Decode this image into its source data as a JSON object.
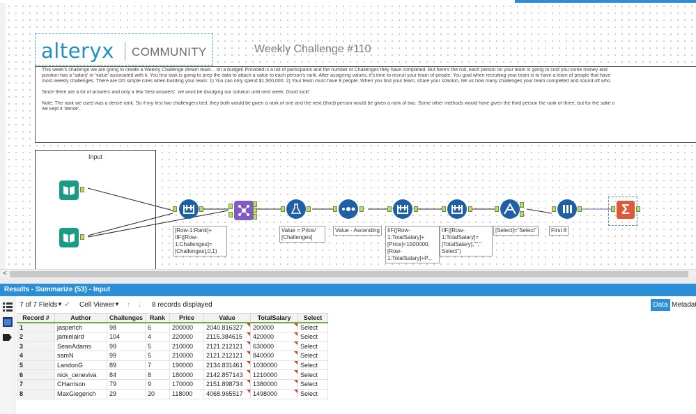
{
  "canvas": {
    "logo_word": "alteryx",
    "logo_sub": "COMMUNITY",
    "challenge_title": "Weekly Challenge #110",
    "comment_paragraphs": [
      "This week's challenge we are going to create a Weekly Challenge dream team... on a budget!  Provided is a list of participants and the number of Challenges they have completed. But here's the rub,  each person on your team is going to cost you some money and",
      "position has a 'salary' or 'value' associated with it.  You first task is going to prep the data to attach a value to each person's rank. After assigning values, it's time to recruit your team of people. You goal when recruiting your team is to have a team of people that have",
      "most weekly challenges. There are t20 simple rules when building your team: 1) You can only spend $1,500,000. 2) Your team must have 8 people. When you find your team, share your solution, tell us how many challenges your team completed and sound off who",
      "Since there are a lot of answers and only a few 'best answers', we wont be divulging our solution until next week. Good luck!",
      "Note: The rank we used was a dense rank. So if my first two challengers tied, they both would be given a rank of one and the next (third) person would be given a rank of two. Some other methods would have given the third person the rank of three, but for the sake o",
      "we kept it 'dense'."
    ],
    "input_container_label": "Input",
    "tool_labels": {
      "formula1": "[Row-1:Rank]+\nIIF([Row-\n1:Challenges]=\n[Challenges],0,1)",
      "formula2": "Value = Price/\n[Challenges]",
      "sort": "Value - Ascending",
      "multirow": "IIF([Row-\n1:TotalSalary]+\n[Price]<1500000,\n[Row-\n1:TotalSalary]+P...",
      "multirow2": "IIF([Row-\n1:TotalSalary]=\n[TotalSalary],\"\",\"\nSelect\")",
      "filter": "[Select]=\"Select\"",
      "sample": "First 8"
    }
  },
  "results": {
    "header": "Results - Summarize (53) - Input",
    "fields": "7 of 7 Fields",
    "viewer": "Cell Viewer",
    "records_displayed": "8 records displayed",
    "tab_data": "Data",
    "tab_meta": "Metadat",
    "columns": [
      "Record #",
      "Author",
      "Challenges",
      "Rank",
      "Price",
      "Value",
      "TotalSalary",
      "Select"
    ],
    "rows": [
      [
        "1",
        "jasperlch",
        "98",
        "6",
        "200000",
        "2040.816327",
        "200000",
        "Select"
      ],
      [
        "2",
        "jamielaird",
        "104",
        "4",
        "220000",
        "2115.384615",
        "420000",
        "Select"
      ],
      [
        "3",
        "SeanAdams",
        "99",
        "5",
        "210000",
        "2121.212121",
        "630000",
        "Select"
      ],
      [
        "4",
        "samN",
        "99",
        "5",
        "210000",
        "2121.212121",
        "840000",
        "Select"
      ],
      [
        "5",
        "LandonG",
        "89",
        "7",
        "190000",
        "2134.831461",
        "1030000",
        "Select"
      ],
      [
        "6",
        "nick_ceneviva",
        "84",
        "8",
        "180000",
        "2142.857143",
        "1210000",
        "Select"
      ],
      [
        "7",
        "CHarrison",
        "79",
        "9",
        "170000",
        "2151.898734",
        "1380000",
        "Select"
      ],
      [
        "8",
        "MaxGiegerich",
        "29",
        "20",
        "118000",
        "4068.965517",
        "1498000",
        "Select"
      ]
    ]
  }
}
